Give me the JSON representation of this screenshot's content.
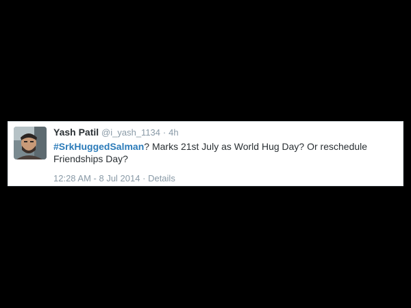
{
  "tweet": {
    "display_name": "Yash Patil",
    "handle": "@i_yash_1134",
    "separator": "·",
    "age": "4h",
    "hashtag_prefix": "#",
    "hashtag": "SrkHuggedSalman",
    "body_text": "? Marks 21st July as World Hug Day? Or reschedule Friendships Day?",
    "timestamp": "12:28 AM - 8 Jul 2014",
    "meta_separator": "·",
    "details_label": "Details"
  },
  "colors": {
    "background": "#000000",
    "card": "#ffffff",
    "name": "#292f33",
    "muted": "#8899a6",
    "hashtag": "#2b7bb9"
  },
  "icons": {
    "avatar": "user-avatar-photo"
  }
}
